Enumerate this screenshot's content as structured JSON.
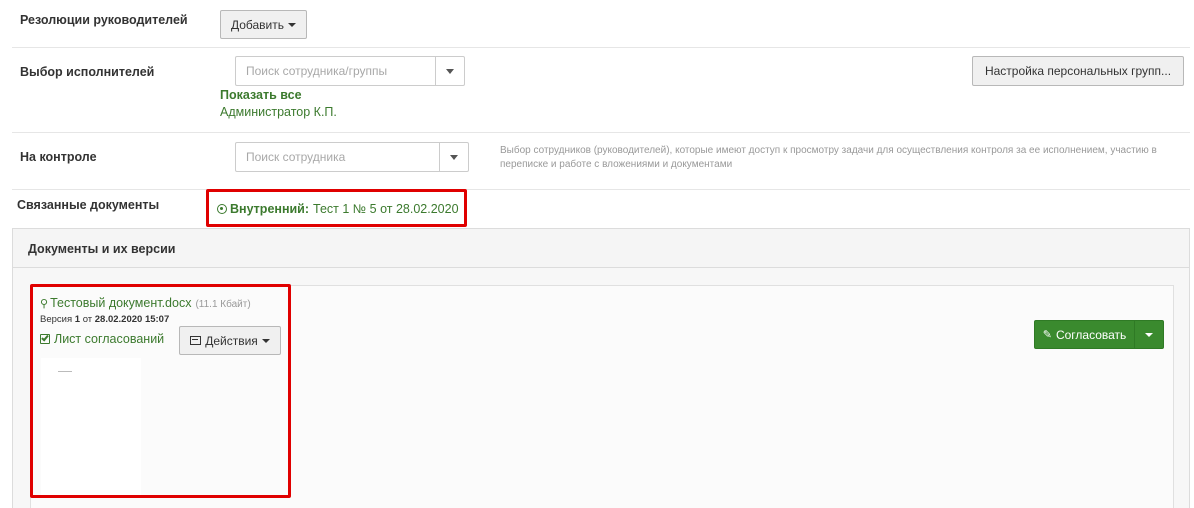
{
  "resolutions": {
    "label": "Резолюции руководителей",
    "add_label": "Добавить"
  },
  "executors": {
    "label": "Выбор исполнителей",
    "search_placeholder": "Поиск сотрудника/группы",
    "personal_groups_label": "Настройка персональных групп...",
    "show_all": "Показать все",
    "selected": "Администратор К.П."
  },
  "control": {
    "label": "На контроле",
    "search_placeholder": "Поиск сотрудника",
    "hint": "Выбор сотрудников (руководителей), которые имеют доступ к просмотру задачи для осуществления контроля за ее исполнением, участию в переписке и работе с вложениями и документами"
  },
  "related": {
    "label": "Связанные документы",
    "type": "Внутренний:",
    "title": "Тест 1 № 5 от 28.02.2020"
  },
  "documents": {
    "panel_title": "Документы и их версии",
    "file_name": "Тестовый документ.docx",
    "file_size": "(11.1 Кбайт)",
    "version_prefix": "Версия",
    "version_number": "1",
    "version_from": "от",
    "version_date": "28.02.2020 15:07",
    "approval_sheet": "Лист согласований",
    "actions_label": "Действия",
    "approve_label": "Согласовать"
  },
  "colors": {
    "accent_green": "#3a8a2e",
    "highlight_red": "#e00000"
  }
}
